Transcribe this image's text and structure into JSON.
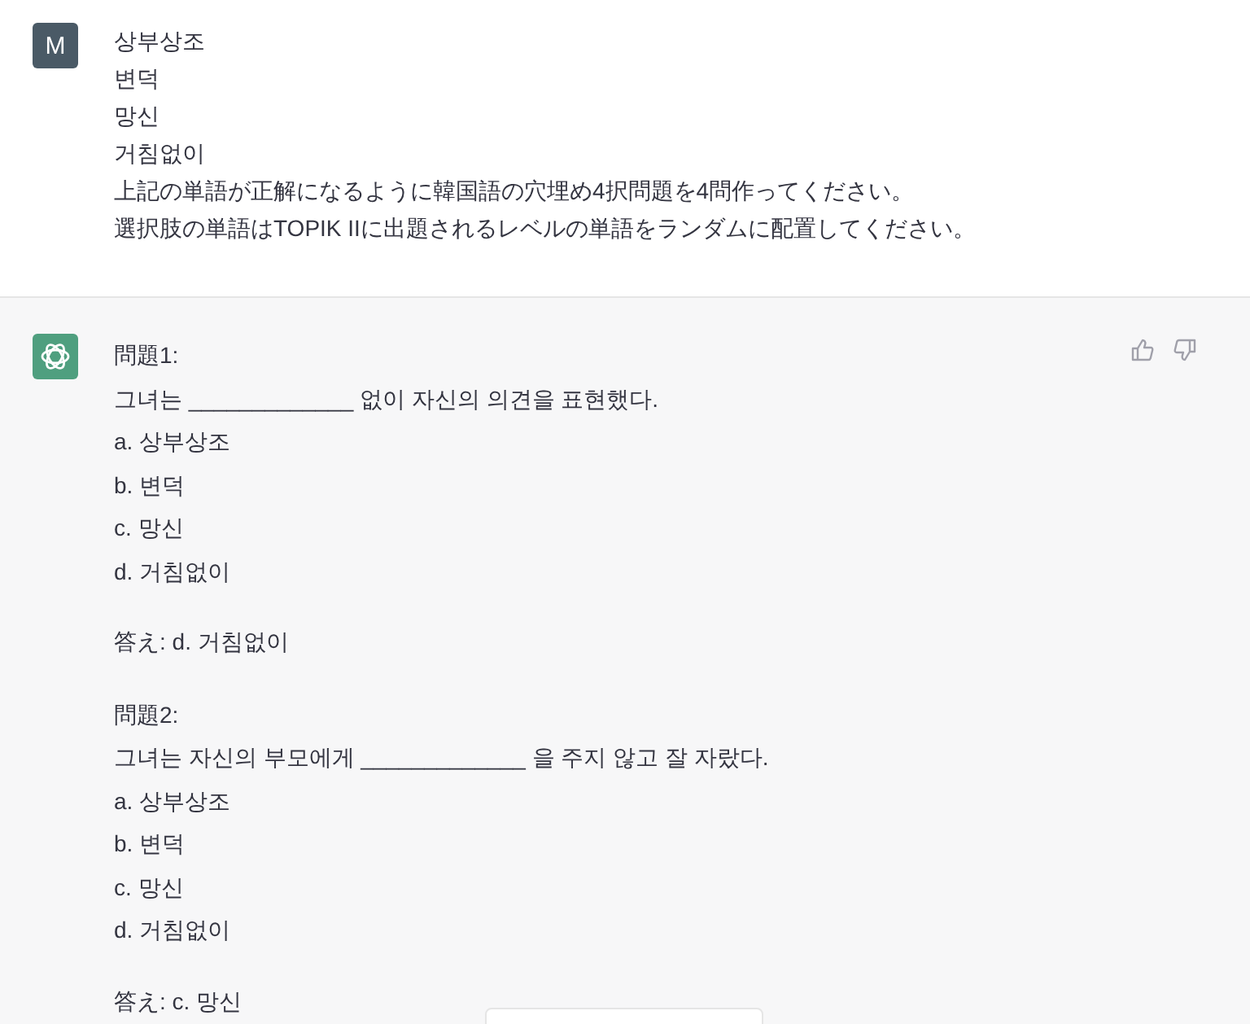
{
  "user_message": {
    "avatar": "M",
    "lines": [
      "상부상조",
      "변덕",
      "망신",
      "거침없이",
      "上記の単語が正解になるように韓国語の穴埋め4択問題を4問作ってください。",
      "選択肢の単語はTOPIK IIに出題されるレベルの単語をランダムに配置してください。"
    ]
  },
  "assistant_message": {
    "questions": [
      {
        "title": "問題1:",
        "sentence": "그녀는 _____________ 없이 자신의 의견을 표현했다.",
        "options": [
          "a. 상부상조",
          "b. 변덕",
          "c. 망신",
          "d. 거침없이"
        ],
        "answer": "答え: d. 거침없이"
      },
      {
        "title": "問題2:",
        "sentence": "그녀는 자신의 부모에게 _____________ 을 주지 않고 잘 자랐다.",
        "options": [
          "a. 상부상조",
          "b. 변덕",
          "c. 망신",
          "d. 거침없이"
        ],
        "answer": "答え: c. 망신"
      }
    ]
  }
}
